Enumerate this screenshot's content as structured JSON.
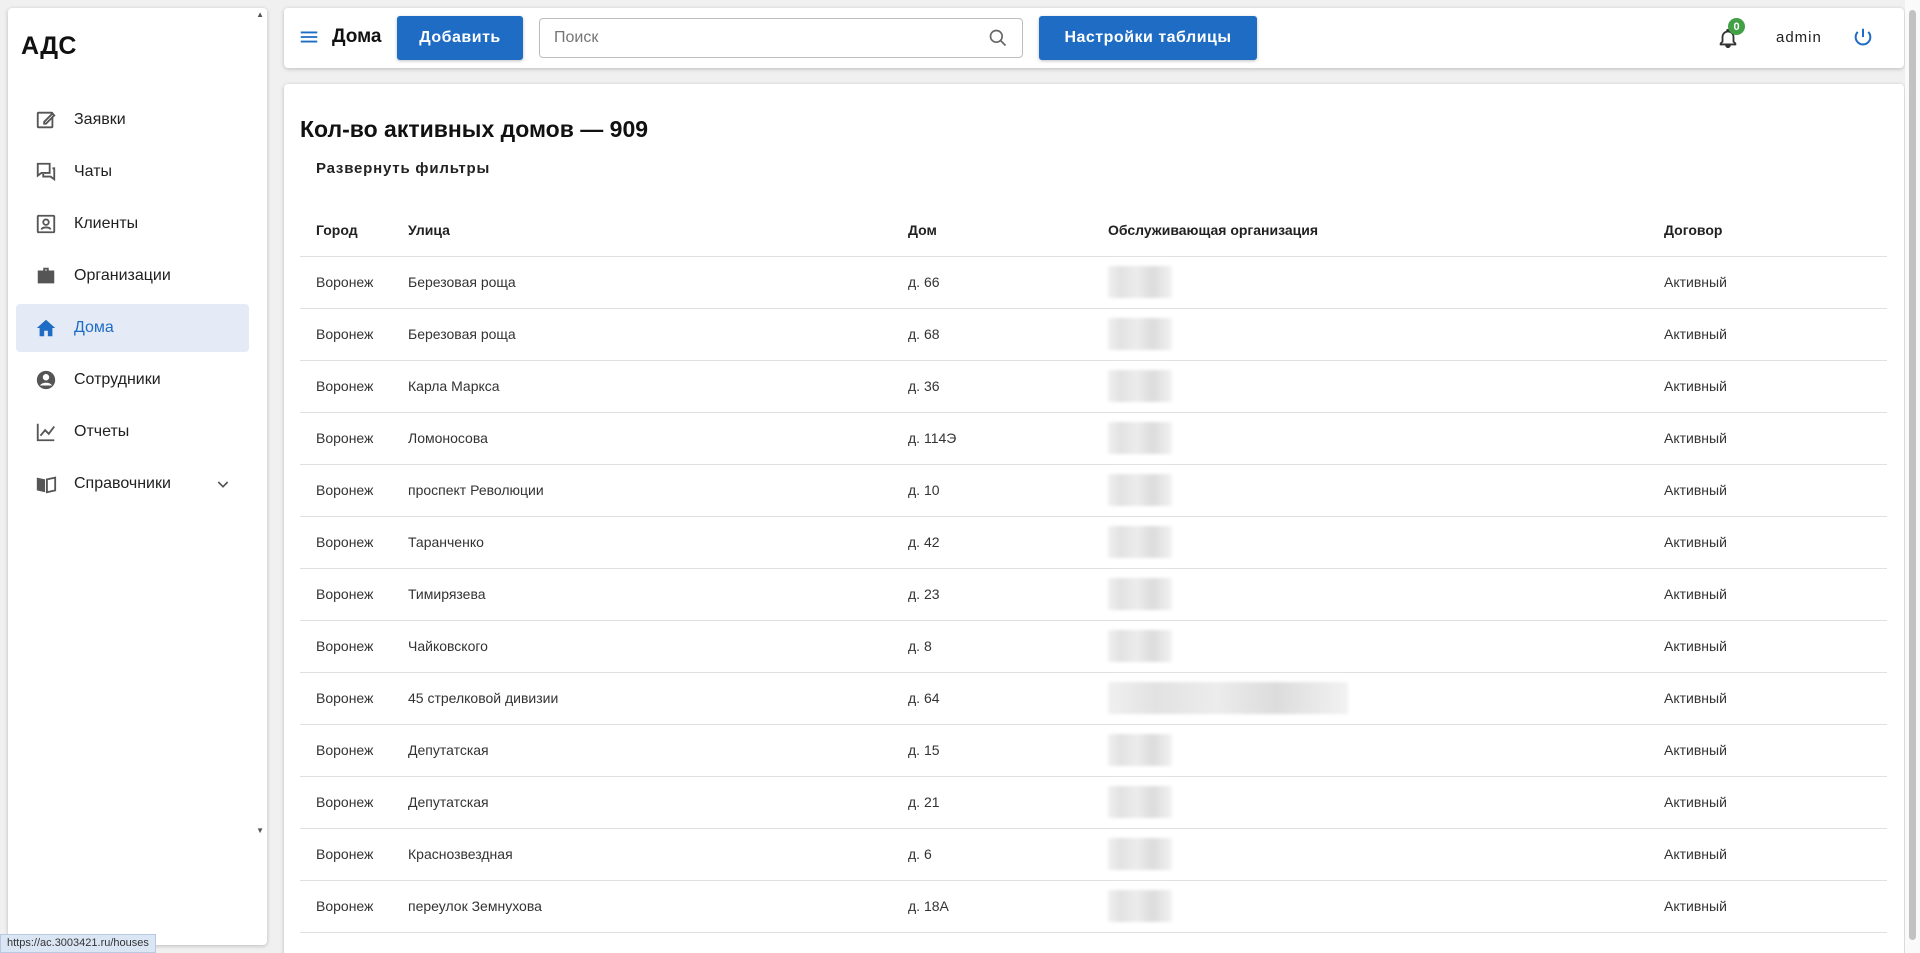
{
  "sidebar": {
    "brand": "АДС",
    "items": [
      {
        "label": "Заявки",
        "icon": "edit-icon"
      },
      {
        "label": "Чаты",
        "icon": "chat-icon"
      },
      {
        "label": "Клиенты",
        "icon": "contact-icon"
      },
      {
        "label": "Организации",
        "icon": "briefcase-icon"
      },
      {
        "label": "Дома",
        "icon": "home-icon",
        "active": true
      },
      {
        "label": "Сотрудники",
        "icon": "account-circle-icon"
      },
      {
        "label": "Отчеты",
        "icon": "chart-line-icon"
      },
      {
        "label": "Справочники",
        "icon": "book-icon",
        "expandable": true
      }
    ]
  },
  "topbar": {
    "title": "Дома",
    "add_label": "Добавить",
    "search_placeholder": "Поиск",
    "settings_label": "Настройки таблицы",
    "notifications_count": "0",
    "username": "admin"
  },
  "main": {
    "count_title": "Кол-во активных домов — 909",
    "filters_label": "Развернуть фильтры",
    "columns": [
      "Город",
      "Улица",
      "Дом",
      "Обслуживающая организация",
      "Договор"
    ],
    "rows": [
      {
        "city": "Воронеж",
        "street": "Березовая роща",
        "house": "д. 66",
        "contract": "Активный"
      },
      {
        "city": "Воронеж",
        "street": "Березовая роща",
        "house": "д. 68",
        "contract": "Активный"
      },
      {
        "city": "Воронеж",
        "street": "Карла Маркса",
        "house": "д. 36",
        "contract": "Активный"
      },
      {
        "city": "Воронеж",
        "street": "Ломоносова",
        "house": "д. 114Э",
        "contract": "Активный"
      },
      {
        "city": "Воронеж",
        "street": "проспект Революции",
        "house": "д. 10",
        "contract": "Активный"
      },
      {
        "city": "Воронеж",
        "street": "Таранченко",
        "house": "д. 42",
        "contract": "Активный"
      },
      {
        "city": "Воронеж",
        "street": "Тимирязева",
        "house": "д. 23",
        "contract": "Активный"
      },
      {
        "city": "Воронеж",
        "street": "Чайковского",
        "house": "д. 8",
        "contract": "Активный"
      },
      {
        "city": "Воронеж",
        "street": "45 стрелковой дивизии",
        "house": "д. 64",
        "contract": "Активный"
      },
      {
        "city": "Воронеж",
        "street": "Депутатская",
        "house": "д. 15",
        "contract": "Активный"
      },
      {
        "city": "Воронеж",
        "street": "Депутатская",
        "house": "д. 21",
        "contract": "Активный"
      },
      {
        "city": "Воронеж",
        "street": "Краснозвездная",
        "house": "д. 6",
        "contract": "Активный"
      },
      {
        "city": "Воронеж",
        "street": "переулок Земнухова",
        "house": "д. 18А",
        "contract": "Активный"
      }
    ]
  },
  "statusbar": {
    "url": "https://ac.3003421.ru/houses"
  },
  "colors": {
    "primary": "#1e6cc4",
    "active_bg": "#e4ebf6",
    "badge": "#43a047"
  }
}
